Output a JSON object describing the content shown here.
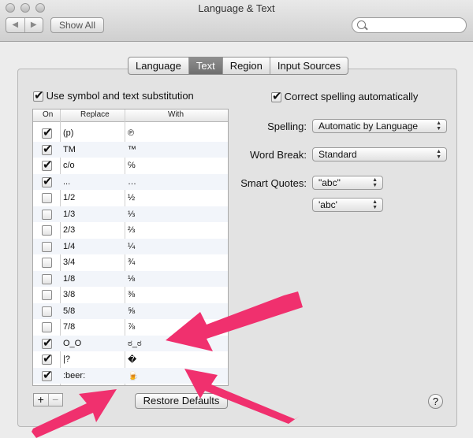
{
  "window": {
    "title": "Language & Text"
  },
  "toolbar": {
    "back_label": "◀",
    "forward_label": "▶",
    "show_all_label": "Show All",
    "search_placeholder": ""
  },
  "tabs": [
    "Language",
    "Text",
    "Region",
    "Input Sources"
  ],
  "active_tab": "Text",
  "use_substitution": {
    "label": "Use symbol and text substitution",
    "checked": true
  },
  "table": {
    "headers": {
      "on": "On",
      "replace": "Replace",
      "with": "With"
    },
    "rows": [
      {
        "on": true,
        "replace": "(p)",
        "with": "℗"
      },
      {
        "on": true,
        "replace": "TM",
        "with": "™"
      },
      {
        "on": true,
        "replace": "c/o",
        "with": "℅"
      },
      {
        "on": true,
        "replace": "...",
        "with": "…"
      },
      {
        "on": false,
        "replace": "1/2",
        "with": "½"
      },
      {
        "on": false,
        "replace": "1/3",
        "with": "⅓"
      },
      {
        "on": false,
        "replace": "2/3",
        "with": "⅔"
      },
      {
        "on": false,
        "replace": "1/4",
        "with": "¼"
      },
      {
        "on": false,
        "replace": "3/4",
        "with": "¾"
      },
      {
        "on": false,
        "replace": "1/8",
        "with": "⅛"
      },
      {
        "on": false,
        "replace": "3/8",
        "with": "⅜"
      },
      {
        "on": false,
        "replace": "5/8",
        "with": "⅝"
      },
      {
        "on": false,
        "replace": "7/8",
        "with": "⅞"
      },
      {
        "on": true,
        "replace": "O_O",
        "with": "ಠ_ಠ"
      },
      {
        "on": true,
        "replace": "|?",
        "with": "�"
      },
      {
        "on": true,
        "replace": ":beer:",
        "with": "🍺"
      }
    ]
  },
  "add_label": "+",
  "remove_label": "−",
  "restore_defaults_label": "Restore Defaults",
  "correct_spelling": {
    "label": "Correct spelling automatically",
    "checked": true
  },
  "spelling": {
    "label": "Spelling:",
    "value": "Automatic by Language"
  },
  "word_break": {
    "label": "Word Break:",
    "value": "Standard"
  },
  "smart_quotes": {
    "label": "Smart Quotes:",
    "double_value": "\"abc\"",
    "single_value": "'abc'"
  },
  "help_label": "?",
  "colors": {
    "accent_annotation": "#f0306e"
  }
}
